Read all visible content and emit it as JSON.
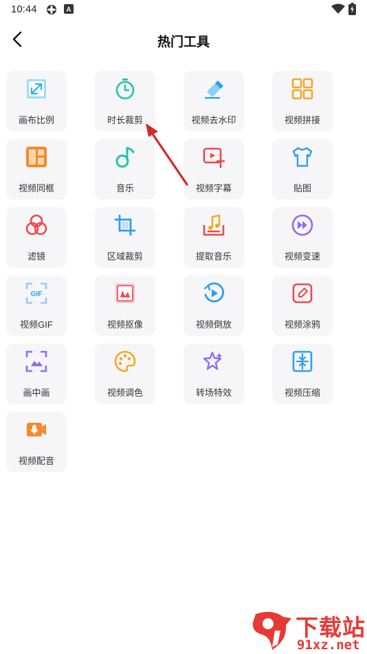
{
  "status_bar": {
    "time": "10:44",
    "indicator_letter": "A"
  },
  "header": {
    "title": "热门工具",
    "back_icon": "chevron-left-icon"
  },
  "tools": [
    {
      "label": "画布比例",
      "icon": "canvas-ratio-icon",
      "color": "#2bb3f0"
    },
    {
      "label": "时长裁剪",
      "icon": "stopwatch-icon",
      "color": "#22c3a6"
    },
    {
      "label": "视频去水印",
      "icon": "eraser-icon",
      "color": "#2f9df0"
    },
    {
      "label": "视频拼接",
      "icon": "grid-join-icon",
      "color": "#f5a623"
    },
    {
      "label": "视频同框",
      "icon": "split-frame-icon",
      "color": "#f58a2a"
    },
    {
      "label": "音乐",
      "icon": "music-note-icon",
      "color": "#22c3a6"
    },
    {
      "label": "视频字幕",
      "icon": "subtitle-icon",
      "color": "#f0484e"
    },
    {
      "label": "贴图",
      "icon": "shirt-icon",
      "color": "#2f9df0"
    },
    {
      "label": "滤镜",
      "icon": "filter-circles-icon",
      "color": "#f0484e"
    },
    {
      "label": "区域裁剪",
      "icon": "crop-icon",
      "color": "#2f9df0"
    },
    {
      "label": "提取音乐",
      "icon": "extract-music-icon",
      "color": "#f0484e"
    },
    {
      "label": "视频变速",
      "icon": "fast-forward-icon",
      "color": "#8e6cf0"
    },
    {
      "label": "视频GIF",
      "icon": "gif-icon",
      "color": "#2f9df0"
    },
    {
      "label": "视频抠像",
      "icon": "cutout-icon",
      "color": "#f0484e"
    },
    {
      "label": "视频倒放",
      "icon": "reverse-play-icon",
      "color": "#2f9df0"
    },
    {
      "label": "视频涂鸦",
      "icon": "doodle-icon",
      "color": "#f0484e"
    },
    {
      "label": "画中画",
      "icon": "picture-in-picture-icon",
      "color": "#8e6cf0"
    },
    {
      "label": "视频调色",
      "icon": "palette-icon",
      "color": "#f5a623"
    },
    {
      "label": "转场特效",
      "icon": "transition-star-icon",
      "color": "#8e6cf0"
    },
    {
      "label": "视频压缩",
      "icon": "compress-icon",
      "color": "#2f9df0"
    },
    {
      "label": "视频配音",
      "icon": "voiceover-icon",
      "color": "#f58a2a"
    }
  ],
  "annotation": {
    "arrow_color": "#d8282c"
  },
  "watermark": {
    "title": "下载站",
    "url": "91xz.net",
    "color": "#e63a36"
  }
}
